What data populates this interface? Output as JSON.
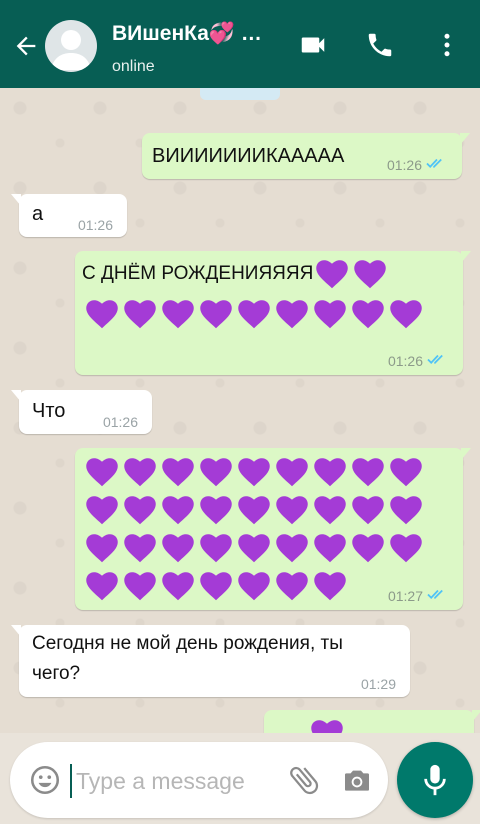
{
  "header": {
    "contact_name": "ВИшенКа💞 …",
    "status": "online",
    "colors": {
      "bar": "#075e54",
      "icons": "#ffffff"
    },
    "icons": [
      "back-arrow-icon",
      "avatar",
      "video-call-icon",
      "phone-call-icon",
      "more-options-icon"
    ]
  },
  "messages": [
    {
      "direction": "out",
      "text": "ВИИИИИИИКААААА",
      "time": "01:26",
      "status": "read"
    },
    {
      "direction": "in",
      "text": "а",
      "time": "01:26"
    },
    {
      "direction": "out",
      "text": "С ДНЁМ РОЖДЕНИЯЯЯЯ",
      "hearts_after_text": 11,
      "time": "01:26",
      "status": "read"
    },
    {
      "direction": "in",
      "text": "Что",
      "time": "01:26"
    },
    {
      "direction": "out",
      "text": "",
      "hearts": 34,
      "time": "01:27",
      "status": "read"
    },
    {
      "direction": "in",
      "text": "Сегодня не мой день рождения, ты чего?",
      "line1": "Сегодня не мой день рождения, ты",
      "line2": "чего?",
      "time": "01:29"
    },
    {
      "direction": "out",
      "text": "",
      "hearts": 1,
      "partial": true
    }
  ],
  "colors": {
    "heart": "#a43bd6",
    "outgoing_bubble": "#dcf8c6",
    "incoming_bubble": "#ffffff",
    "read_ticks": "#4fc3f7"
  },
  "composer": {
    "placeholder": "Type a message",
    "icons": [
      "emoji-icon",
      "attach-icon",
      "camera-icon",
      "mic-icon"
    ]
  }
}
